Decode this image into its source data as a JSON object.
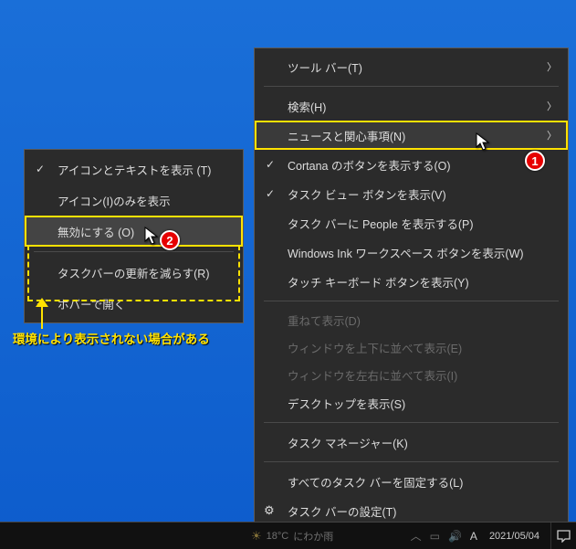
{
  "mainMenu": {
    "toolbar": "ツール バー(T)",
    "search": "検索(H)",
    "news": "ニュースと関心事項(N)",
    "cortana": "Cortana のボタンを表示する(O)",
    "taskview": "タスク ビュー ボタンを表示(V)",
    "people": "タスク バーに People を表示する(P)",
    "ink": "Windows Ink ワークスペース ボタンを表示(W)",
    "touchkb": "タッチ キーボード ボタンを表示(Y)",
    "cascade": "重ねて表示(D)",
    "stackv": "ウィンドウを上下に並べて表示(E)",
    "stackh": "ウィンドウを左右に並べて表示(I)",
    "showdesk": "デスクトップを表示(S)",
    "taskmgr": "タスク マネージャー(K)",
    "lockall": "すべてのタスク バーを固定する(L)",
    "settings": "タスク バーの設定(T)"
  },
  "subMenu": {
    "iconText": "アイコンとテキストを表示 (T)",
    "iconOnly": "アイコン(I)のみを表示",
    "disable": "無効にする (O)",
    "reduce": "タスクバーの更新を減らす(R)",
    "hover": "ホバーで開く"
  },
  "annotations": {
    "note": "環境により表示されない場合がある",
    "badge1": "1",
    "badge2": "2"
  },
  "taskbar": {
    "weatherTemp": "18°C",
    "weatherText": "にわか雨",
    "ime": "A",
    "date": "2021/05/04"
  }
}
